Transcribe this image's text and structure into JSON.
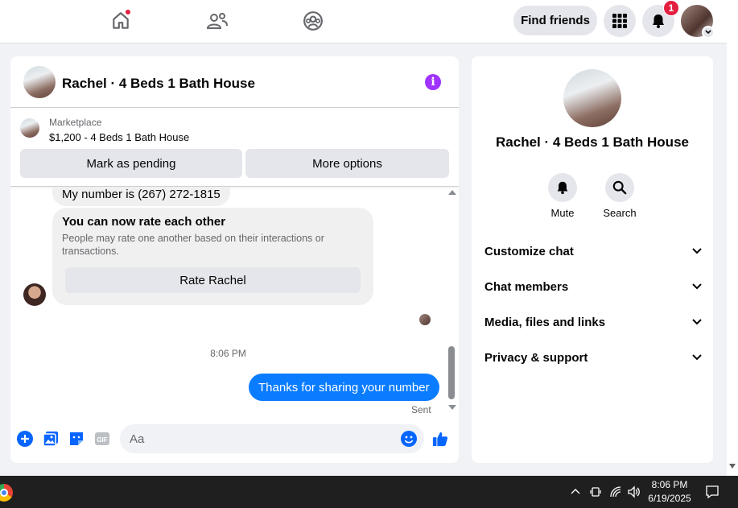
{
  "topnav": {
    "find_friends": "Find friends",
    "notification_count": "1"
  },
  "chat": {
    "title": "Rachel · 4 Beds 1 Bath House",
    "marketplace": {
      "label": "Marketplace",
      "listing": "$1,200 - 4 Beds 1 Bath House",
      "mark_pending": "Mark as pending",
      "more_options": "More options"
    },
    "messages": {
      "number_msg": "My number is (267) 272-1815",
      "rate_title": "You can now rate each other",
      "rate_desc": "People may rate one another based on their interactions or transactions.",
      "rate_button": "Rate Rachel",
      "time": "8:06 PM",
      "outgoing": "Thanks for sharing your number",
      "status": "Sent"
    },
    "composer": {
      "placeholder": "Aa"
    }
  },
  "info_panel": {
    "name": "Rachel · 4 Beds 1 Bath House",
    "actions": [
      {
        "label": "Mute",
        "icon": "bell-icon"
      },
      {
        "label": "Search",
        "icon": "search-icon"
      }
    ],
    "sections": [
      "Customize chat",
      "Chat members",
      "Media, files and links",
      "Privacy & support"
    ]
  },
  "taskbar": {
    "time": "8:06 PM",
    "date": "6/19/2025"
  },
  "colors": {
    "accent": "#0a7cff",
    "info_purple": "#a033ff",
    "badge_red": "#e41e3f"
  }
}
